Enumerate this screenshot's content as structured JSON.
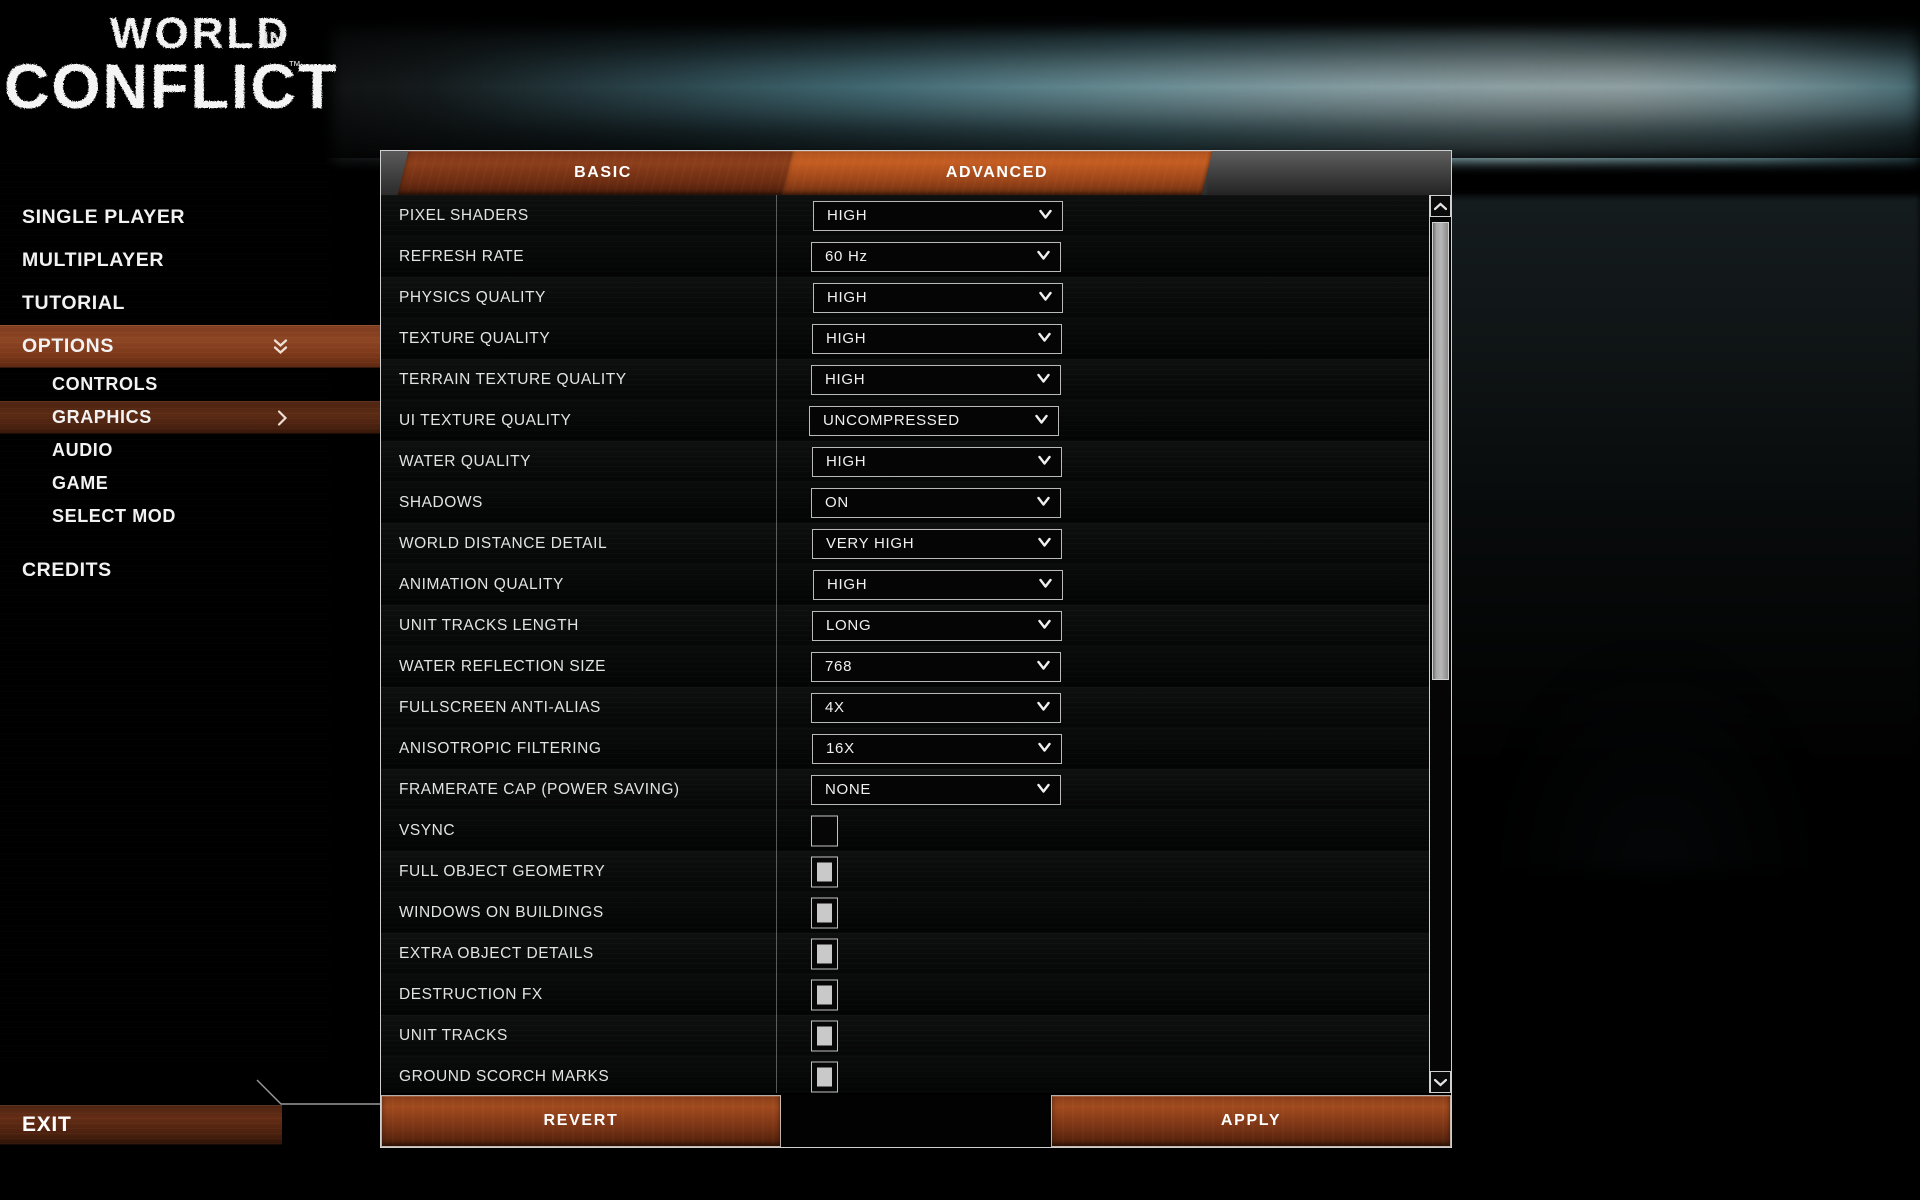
{
  "game": {
    "logo_line1": "WORLD",
    "logo_in": "IN",
    "logo_line2": "CONFLICT",
    "logo_tm": "™"
  },
  "colors": {
    "accent_orange": "#a14a1e",
    "accent_active_tab": "#c45d22",
    "accent_sidebar_active": "#8d4523",
    "accent_sidebar_sub": "#5c2b14",
    "panel_border": "#cfcfcf",
    "text": "#e8e8e8",
    "background": "#000000",
    "streak_cyan": "#b9f0fa"
  },
  "sidebar": {
    "items": [
      {
        "label": "SINGLE PLAYER",
        "level": "top",
        "state": "normal",
        "indicator": "none"
      },
      {
        "label": "MULTIPLAYER",
        "level": "top",
        "state": "normal",
        "indicator": "none"
      },
      {
        "label": "TUTORIAL",
        "level": "top",
        "state": "normal",
        "indicator": "none"
      },
      {
        "label": "OPTIONS",
        "level": "top",
        "state": "active",
        "indicator": "double-chevron-down"
      },
      {
        "label": "CONTROLS",
        "level": "sub",
        "state": "normal",
        "indicator": "none"
      },
      {
        "label": "GRAPHICS",
        "level": "sub",
        "state": "active-sub",
        "indicator": "chevron-right"
      },
      {
        "label": "AUDIO",
        "level": "sub",
        "state": "normal",
        "indicator": "none"
      },
      {
        "label": "GAME",
        "level": "sub",
        "state": "normal",
        "indicator": "none"
      },
      {
        "label": "SELECT MOD",
        "level": "sub",
        "state": "normal",
        "indicator": "none"
      },
      {
        "label": "CREDITS",
        "level": "top",
        "state": "normal",
        "indicator": "none"
      }
    ],
    "exit_label": "EXIT"
  },
  "tabs": [
    {
      "id": "basic",
      "label": "BASIC",
      "active": false
    },
    {
      "id": "advanced",
      "label": "ADVANCED",
      "active": true
    }
  ],
  "settings": [
    {
      "label": "PIXEL SHADERS",
      "type": "dropdown",
      "value": "HIGH"
    },
    {
      "label": "REFRESH RATE",
      "type": "dropdown",
      "value": "60 Hz"
    },
    {
      "label": "PHYSICS QUALITY",
      "type": "dropdown",
      "value": "HIGH"
    },
    {
      "label": "TEXTURE QUALITY",
      "type": "dropdown",
      "value": "HIGH"
    },
    {
      "label": "TERRAIN TEXTURE QUALITY",
      "type": "dropdown",
      "value": "HIGH"
    },
    {
      "label": "UI TEXTURE QUALITY",
      "type": "dropdown",
      "value": "UNCOMPRESSED"
    },
    {
      "label": "WATER QUALITY",
      "type": "dropdown",
      "value": "HIGH"
    },
    {
      "label": "SHADOWS",
      "type": "dropdown",
      "value": "ON"
    },
    {
      "label": "WORLD DISTANCE DETAIL",
      "type": "dropdown",
      "value": "VERY HIGH"
    },
    {
      "label": "ANIMATION QUALITY",
      "type": "dropdown",
      "value": "HIGH"
    },
    {
      "label": "UNIT TRACKS LENGTH",
      "type": "dropdown",
      "value": "LONG"
    },
    {
      "label": "WATER REFLECTION SIZE",
      "type": "dropdown",
      "value": "768"
    },
    {
      "label": "FULLSCREEN ANTI-ALIAS",
      "type": "dropdown",
      "value": "4X"
    },
    {
      "label": "ANISOTROPIC FILTERING",
      "type": "dropdown",
      "value": "16X"
    },
    {
      "label": "FRAMERATE CAP (POWER SAVING)",
      "type": "dropdown",
      "value": "NONE"
    },
    {
      "label": "VSYNC",
      "type": "checkbox",
      "checked": false
    },
    {
      "label": "FULL OBJECT GEOMETRY",
      "type": "checkbox",
      "checked": true
    },
    {
      "label": "WINDOWS ON BUILDINGS",
      "type": "checkbox",
      "checked": true
    },
    {
      "label": "EXTRA OBJECT DETAILS",
      "type": "checkbox",
      "checked": true
    },
    {
      "label": "DESTRUCTION FX",
      "type": "checkbox",
      "checked": true
    },
    {
      "label": "UNIT TRACKS",
      "type": "checkbox",
      "checked": true
    },
    {
      "label": "GROUND SCORCH MARKS",
      "type": "checkbox",
      "checked": true
    }
  ],
  "scrollbar": {
    "up_arrow": "chevron-up-icon",
    "down_arrow": "chevron-down-icon",
    "thumb_top_pct": 3,
    "thumb_height_pct": 51
  },
  "footer": {
    "revert_label": "REVERT",
    "apply_label": "APPLY"
  }
}
